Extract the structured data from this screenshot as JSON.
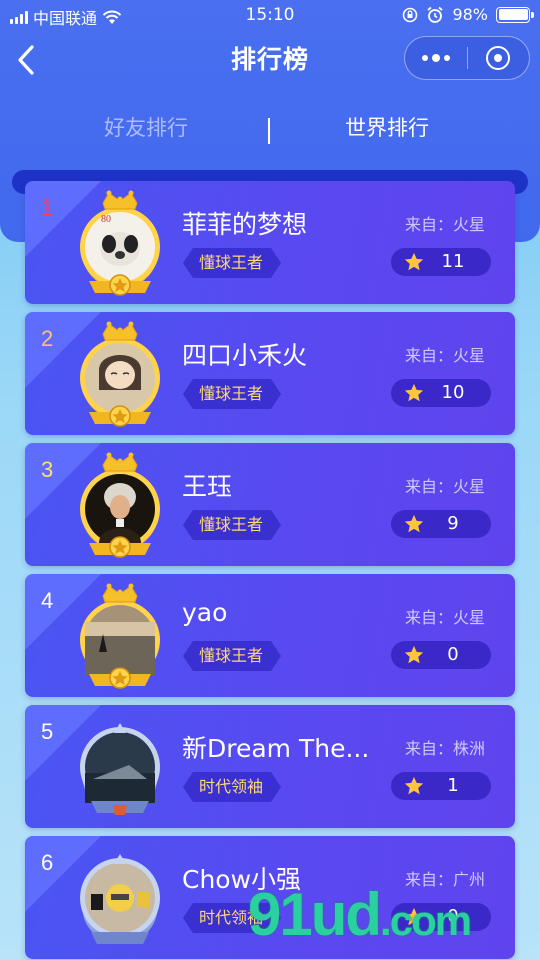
{
  "status_bar": {
    "carrier": "中国联通",
    "time": "15:10",
    "battery": "98%"
  },
  "nav": {
    "title": "排行榜"
  },
  "tabs": {
    "friends": "好友排行",
    "world": "世界排行",
    "active": "world"
  },
  "list": [
    {
      "rank": "1",
      "name": "菲菲的梦想",
      "origin": "来自：火星",
      "badge": "懂球王者",
      "score": "11",
      "frame": "gold"
    },
    {
      "rank": "2",
      "name": "四口小禾火",
      "origin": "来自：火星",
      "badge": "懂球王者",
      "score": "10",
      "frame": "gold"
    },
    {
      "rank": "3",
      "name": "王珏",
      "origin": "来自：火星",
      "badge": "懂球王者",
      "score": "9",
      "frame": "gold"
    },
    {
      "rank": "4",
      "name": "yao",
      "origin": "来自：火星",
      "badge": "懂球王者",
      "score": "0",
      "frame": "gold"
    },
    {
      "rank": "5",
      "name": "新Dream The...",
      "origin": "来自：株洲",
      "badge": "时代领袖",
      "score": "1",
      "frame": "silver"
    },
    {
      "rank": "6",
      "name": "Chow小强",
      "origin": "来自：广州",
      "badge": "时代领袖",
      "score": "0",
      "frame": "silver"
    }
  ],
  "watermark": {
    "main": "91ud",
    "suffix": ".com"
  },
  "colors": {
    "header": "#4169ee",
    "card": "#5a48f0",
    "badge_text": "#ffd77a",
    "rank1": "#ff3d56",
    "rank2": "#ffc078",
    "rank3": "#ffe06b"
  }
}
